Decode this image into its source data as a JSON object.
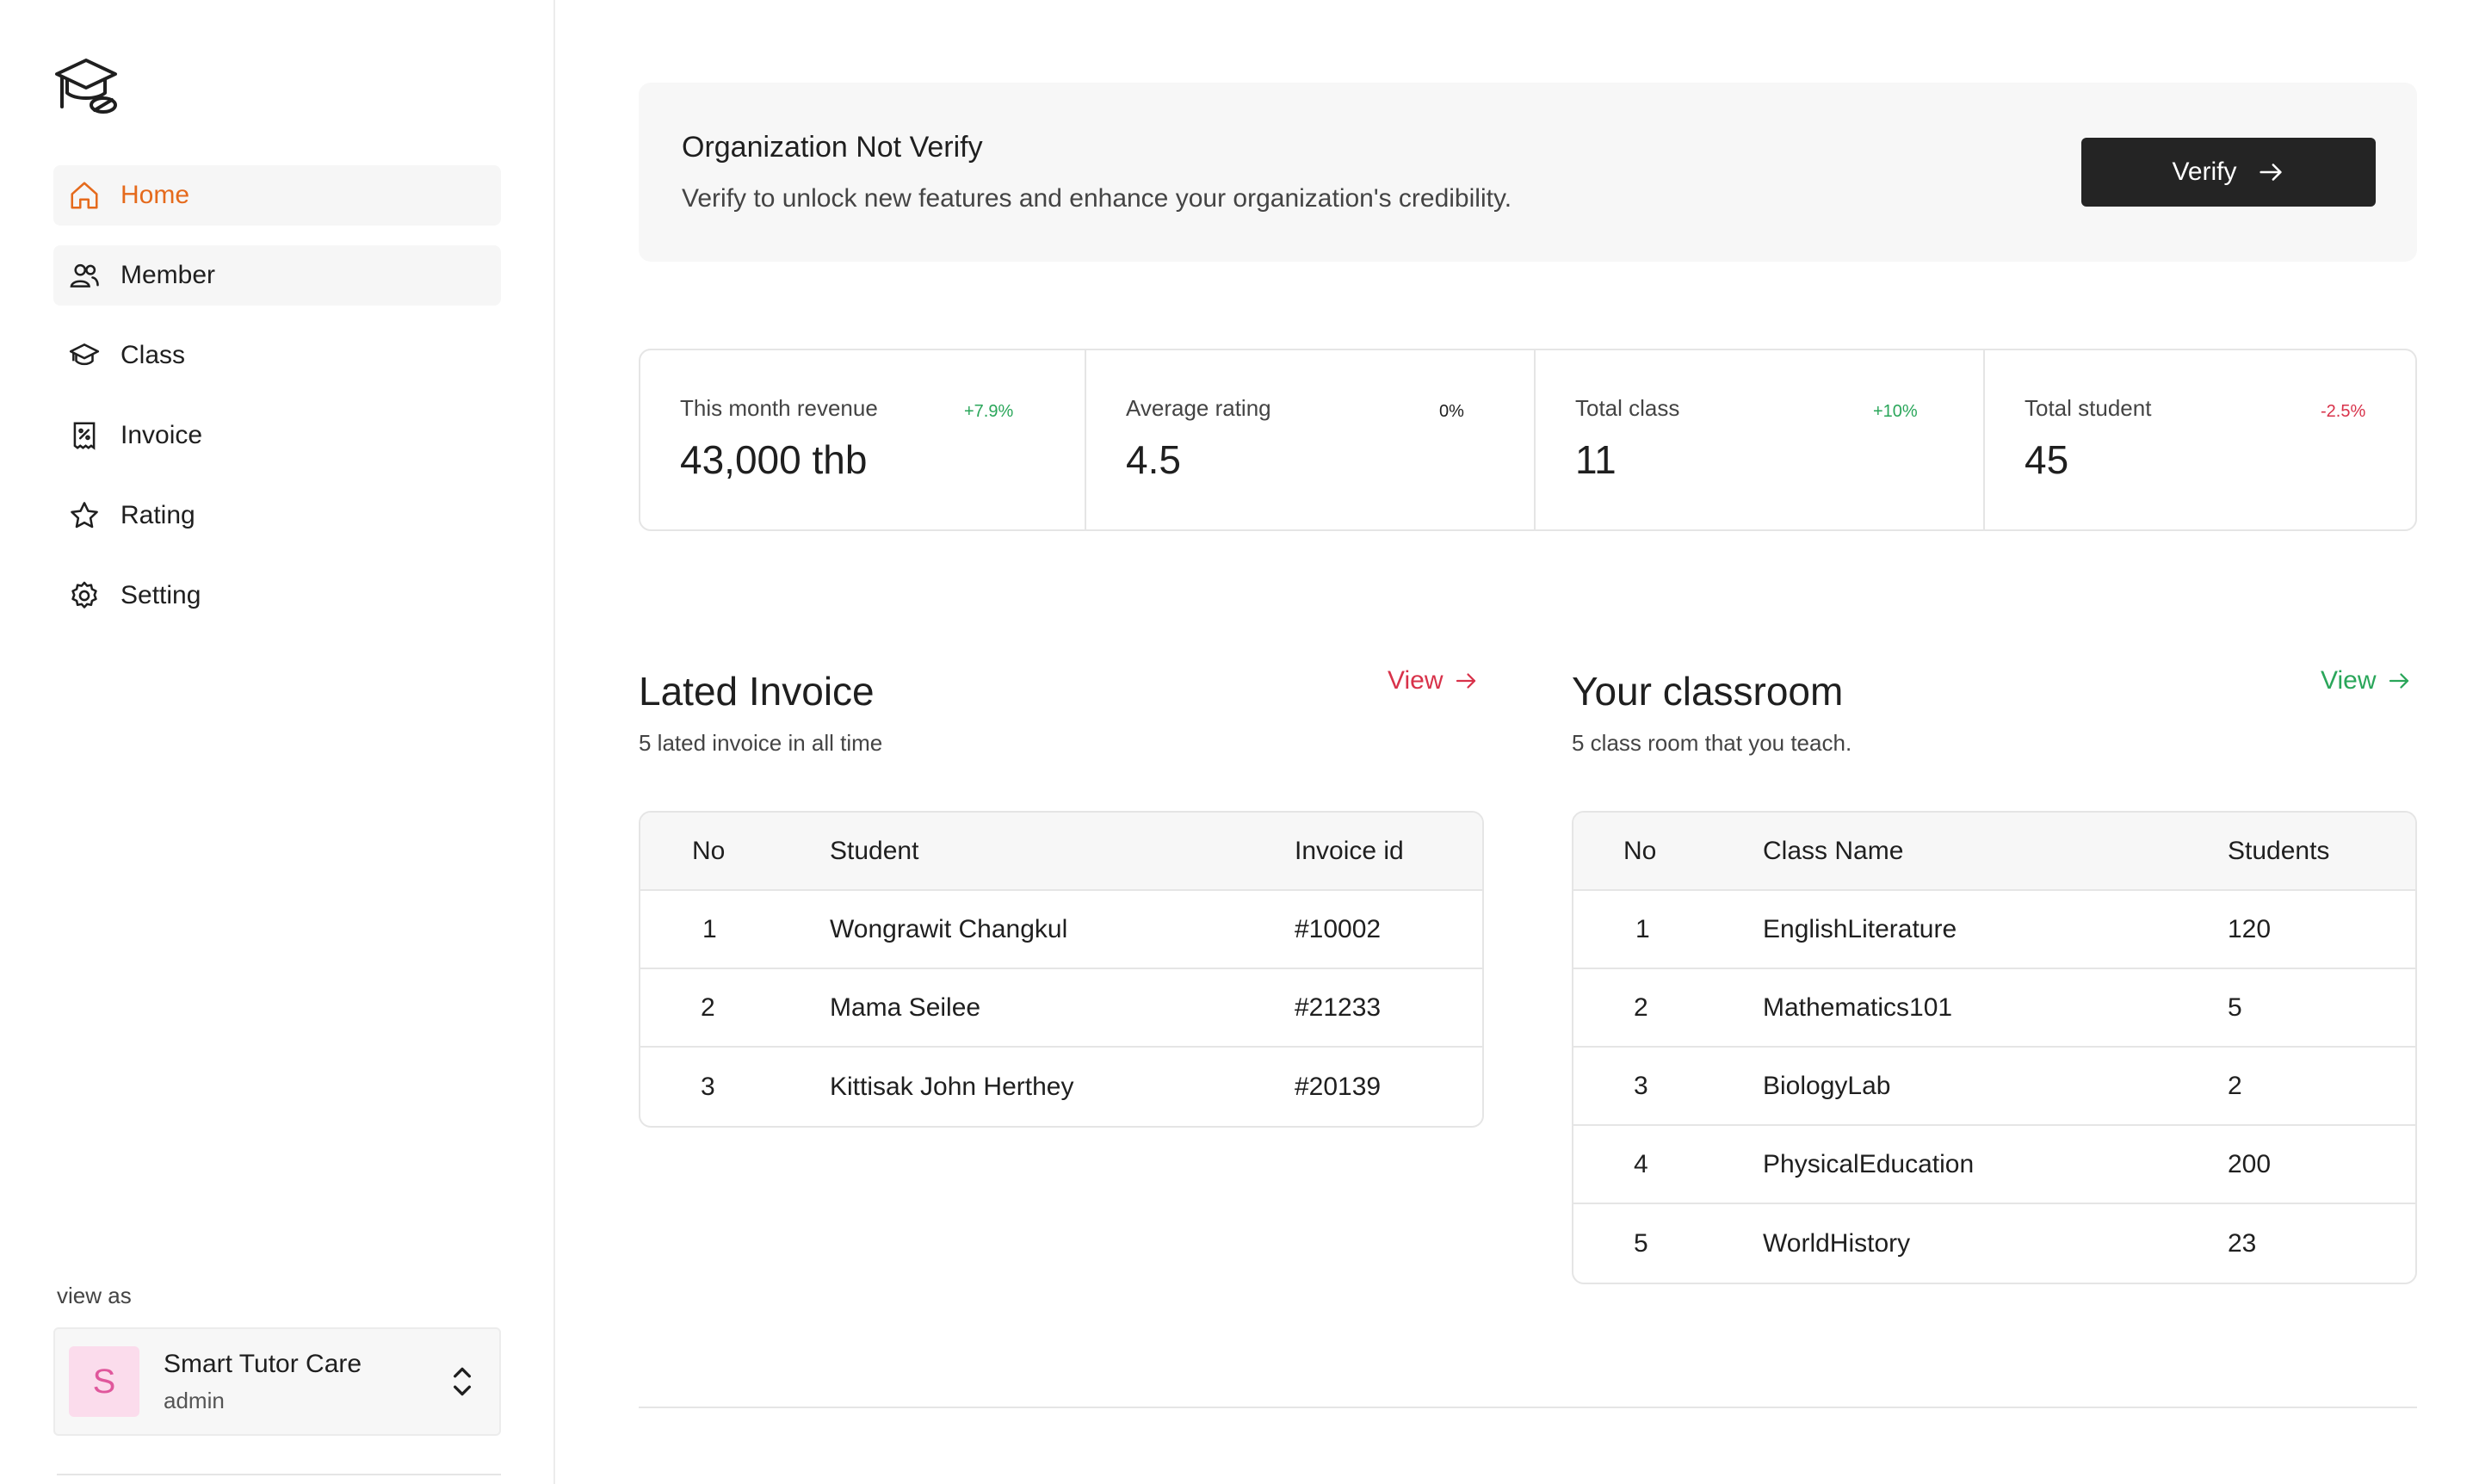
{
  "colors": {
    "accent": "#e56a1c",
    "positive": "#2aa65a",
    "negative": "#d8324a",
    "invoice_link": "#d8324a",
    "classroom_link": "#2aa65a"
  },
  "sidebar": {
    "logo_icon": "graduation-cap-icon",
    "items": [
      {
        "label": "Home",
        "icon": "home-icon",
        "active": true
      },
      {
        "label": "Member",
        "icon": "users-icon"
      },
      {
        "label": "Class",
        "icon": "graduation-cap-icon"
      },
      {
        "label": "Invoice",
        "icon": "receipt-icon"
      },
      {
        "label": "Rating",
        "icon": "star-icon"
      },
      {
        "label": "Setting",
        "icon": "gear-icon"
      }
    ],
    "view_as_label": "view as",
    "org": {
      "avatar_letter": "S",
      "name": "Smart Tutor Care",
      "role": "admin"
    }
  },
  "banner": {
    "title": "Organization Not Verify",
    "subtitle": "Verify to unlock new features and enhance your organization's credibility.",
    "button_label": "Verify"
  },
  "stats": [
    {
      "label": "This month revenue",
      "value": "43,000 thb",
      "delta": "+7.9%",
      "trend": "positive"
    },
    {
      "label": "Average rating",
      "value": "4.5",
      "delta": "0%",
      "trend": "neutral"
    },
    {
      "label": "Total class",
      "value": "11",
      "delta": "+10%",
      "trend": "positive"
    },
    {
      "label": "Total student",
      "value": "45",
      "delta": "-2.5%",
      "trend": "negative"
    }
  ],
  "invoice_section": {
    "title": "Lated Invoice",
    "subtitle": "5 lated invoice in all time",
    "view_label": "View",
    "columns": [
      "No",
      "Student",
      "Invoice id"
    ],
    "rows": [
      [
        "1",
        "Wongrawit Changkul",
        "#10002"
      ],
      [
        "2",
        "Mama Seilee",
        "#21233"
      ],
      [
        "3",
        "Kittisak John Herthey",
        "#20139"
      ]
    ]
  },
  "classroom_section": {
    "title": "Your classroom",
    "subtitle": "5 class room that you teach.",
    "view_label": "View",
    "columns": [
      "No",
      "Class Name",
      "Students"
    ],
    "rows": [
      [
        "1",
        "EnglishLiterature",
        "120"
      ],
      [
        "2",
        "Mathematics101",
        "5"
      ],
      [
        "3",
        "BiologyLab",
        "2"
      ],
      [
        "4",
        "PhysicalEducation",
        "200"
      ],
      [
        "5",
        "WorldHistory",
        "23"
      ]
    ]
  }
}
